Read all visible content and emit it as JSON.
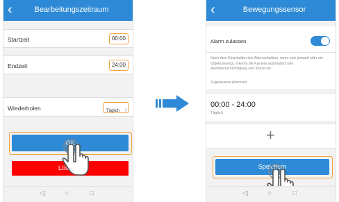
{
  "left_screen": {
    "title": "Bearbeitungszeitraum",
    "back_icon": "‹",
    "start_label": "Startzeit",
    "start_value": "00:00",
    "end_label": "Endzeit",
    "end_value": "24:00",
    "repeat_label": "Wiederholen",
    "repeat_value": "Täglich",
    "ok_label": "OK",
    "delete_label": "Löschen"
  },
  "right_screen": {
    "title": "Bewegungssensor",
    "back_icon": "‹",
    "alarm_label": "Alarm zulassen",
    "alarm_enabled": true,
    "description": "Nach dem Einschalten des Alarmschalters, wenn sich jemand oder ein Objekt bewegt, erkennt die Kamera automatisch die Alarmbenachrichtigung und drückt sie",
    "allowed_time_label": "Zugelassene Alarmzeit",
    "time_range": "00:00 - 24:00",
    "time_repeat": "Täglich",
    "add_icon": "+",
    "save_label": "Speichern"
  },
  "nav_icons": {
    "back": "◁",
    "home": "○",
    "recent": "□"
  },
  "colors": {
    "accent": "#2e8ad6",
    "highlight": "#f0a23a",
    "delete": "#ff0000"
  }
}
